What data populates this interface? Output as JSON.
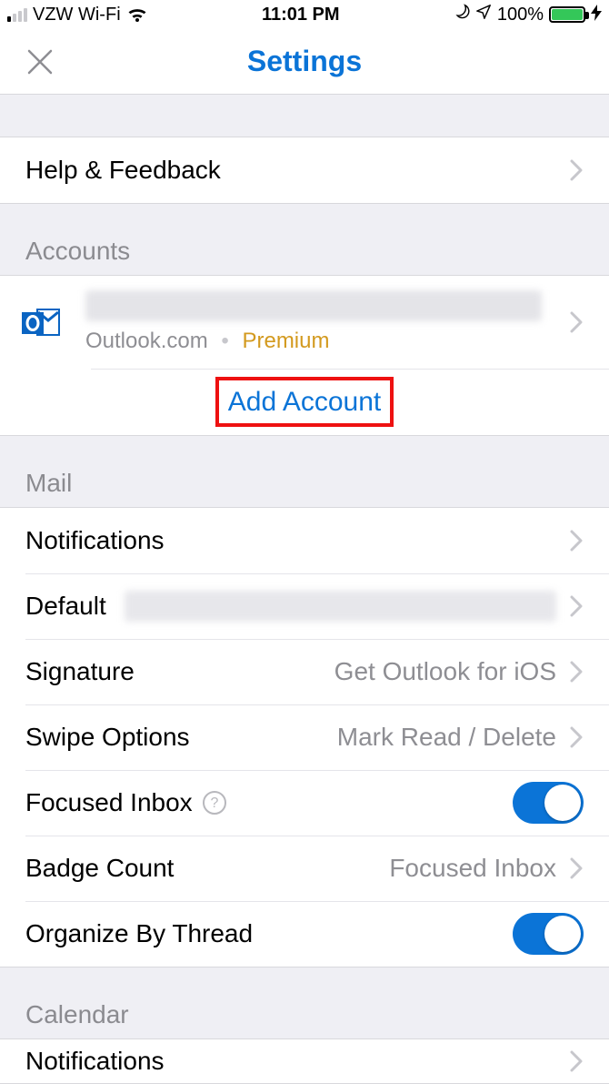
{
  "statusBar": {
    "carrier": "VZW Wi-Fi",
    "time": "11:01 PM",
    "batteryPct": "100%"
  },
  "header": {
    "title": "Settings"
  },
  "sections": {
    "top": {
      "helpFeedback": "Help & Feedback"
    },
    "accounts": {
      "header": "Accounts",
      "provider": "Outlook.com",
      "tier": "Premium",
      "addAccount": "Add Account"
    },
    "mail": {
      "header": "Mail",
      "notifications": "Notifications",
      "defaultLabel": "Default",
      "signature": {
        "label": "Signature",
        "value": "Get Outlook for iOS"
      },
      "swipe": {
        "label": "Swipe Options",
        "value": "Mark Read / Delete"
      },
      "focusedInbox": {
        "label": "Focused Inbox",
        "on": true
      },
      "badgeCount": {
        "label": "Badge Count",
        "value": "Focused Inbox"
      },
      "organizeByThread": {
        "label": "Organize By Thread",
        "on": true
      }
    },
    "calendar": {
      "header": "Calendar",
      "notifications": "Notifications"
    }
  }
}
